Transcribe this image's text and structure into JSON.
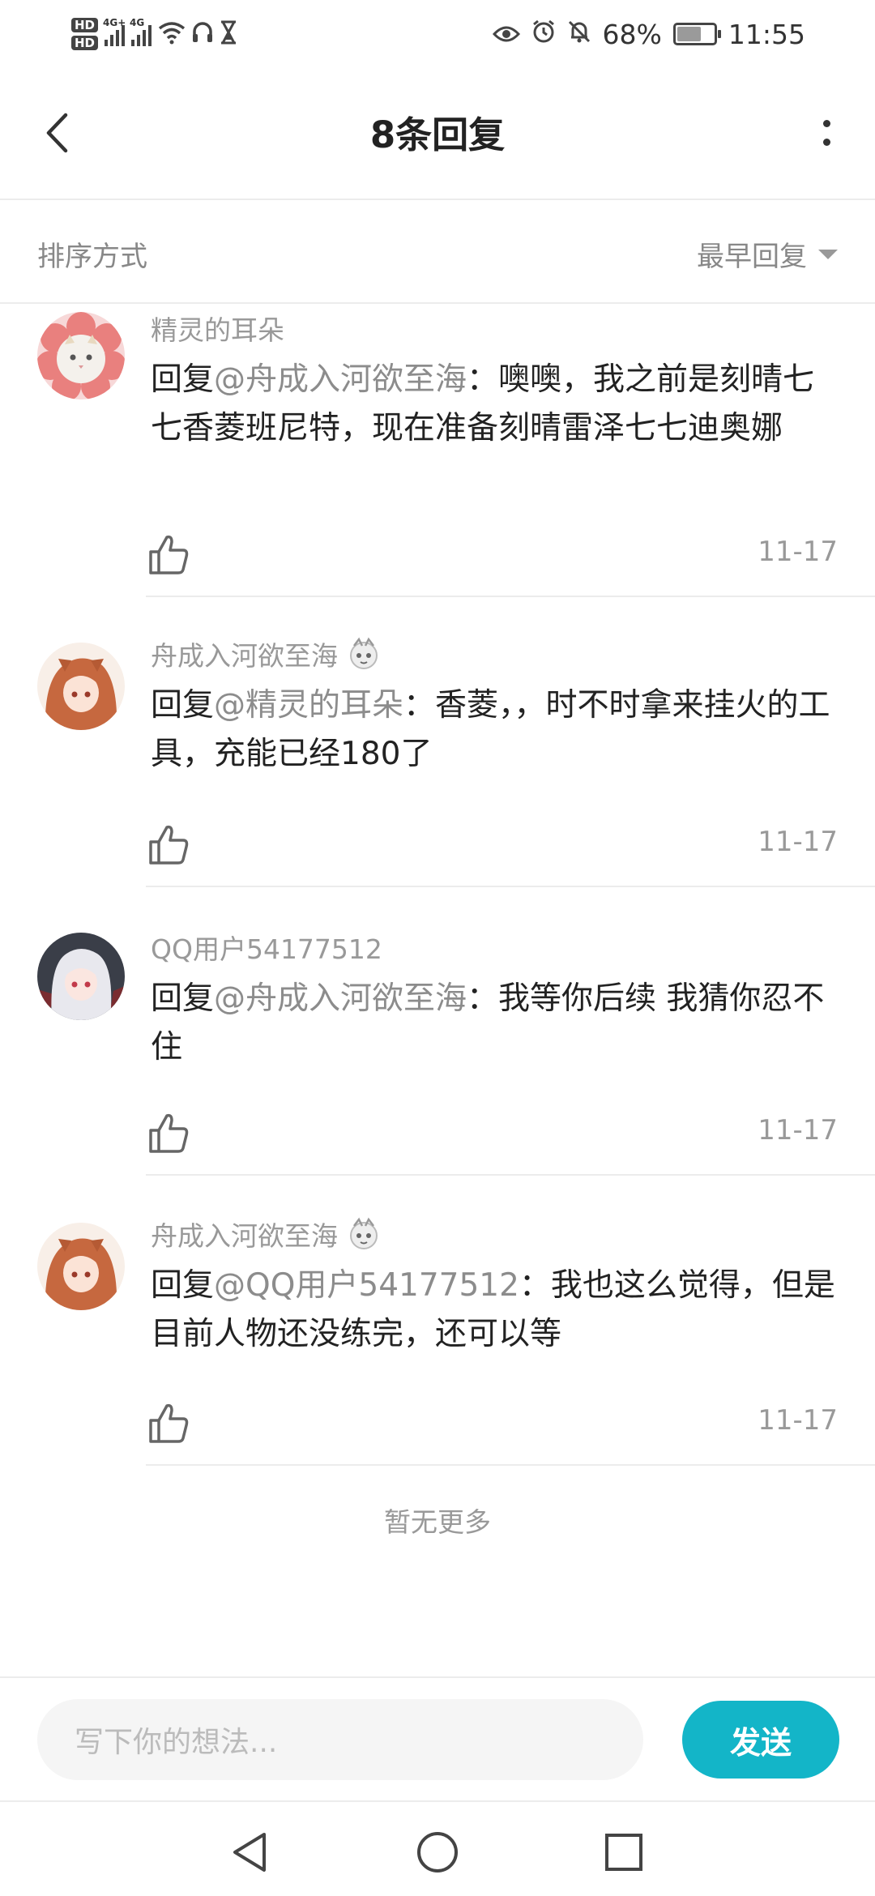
{
  "status_bar": {
    "hd1": "HD",
    "hd2": "HD",
    "sim1_net": "4G+",
    "sim2_net": "4G",
    "battery_percent": "68%",
    "battery_level": 0.68,
    "time": "11:55",
    "icons": [
      "wifi-icon",
      "headset-icon",
      "hourglass-icon",
      "eye-icon",
      "alarm-icon",
      "mute-bell-icon",
      "battery-icon"
    ]
  },
  "header": {
    "title": "8条回复"
  },
  "sort": {
    "label": "排序方式",
    "selected": "最早回复"
  },
  "replies": [
    {
      "username": "精灵的耳朵",
      "prefix": "回复",
      "mention": "@舟成入河欲至海",
      "text": "：噢噢，我之前是刻晴七七香菱班尼特，现在准备刻晴雷泽七七迪奥娜",
      "date": "11-17",
      "avatar": "cat-flower-avatar"
    },
    {
      "username": "舟成入河欲至海",
      "prefix": "回复",
      "mention": "@精灵的耳朵",
      "text": "：香菱，，时不时拿来挂火的工具，充能已经180了",
      "date": "11-17",
      "avatar": "anime-girl-avatar"
    },
    {
      "username": "QQ用户54177512",
      "prefix": "回复",
      "mention": "@舟成入河欲至海",
      "text": "：我等你后续 我猜你忍不住",
      "date": "11-17",
      "avatar": "white-hair-avatar"
    },
    {
      "username": "舟成入河欲至海",
      "prefix": "回复",
      "mention": "@QQ用户54177512",
      "text": "：我也这么觉得，但是目前人物还没练完，还可以等",
      "date": "11-17",
      "avatar": "anime-girl-avatar"
    }
  ],
  "no_more": "暂无更多",
  "input": {
    "placeholder": "写下你的想法...",
    "send_label": "发送"
  },
  "colors": {
    "accent": "#13b5c8",
    "text_primary": "#222222",
    "text_secondary": "#999999"
  }
}
